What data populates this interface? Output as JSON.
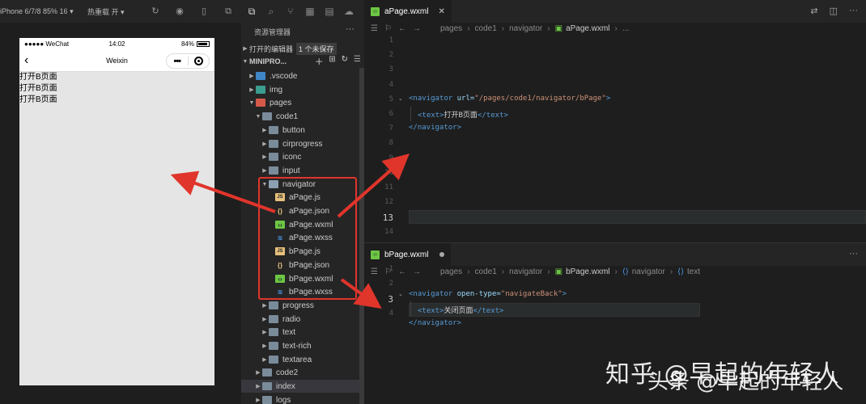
{
  "simulator": {
    "device_label": "iPhone 6/7/8 85% 16 ▾",
    "hot_reload_label": "热重载 开 ▾",
    "phone": {
      "carrier": "●●●●● WeChat",
      "time": "14:02",
      "battery": "84%",
      "nav_title": "Weixin",
      "body_lines": [
        "打开B页面",
        "打开B页面",
        "打开B页面"
      ]
    }
  },
  "explorer": {
    "header": "资源管理器",
    "more": "···",
    "open_editors_label": "打开的编辑器",
    "unsaved_badge": "1 个未保存",
    "project_label": "MINIPRO...",
    "items": [
      {
        "name": ".vscode",
        "type": "folder",
        "color": "blue",
        "level": 1,
        "expanded": false
      },
      {
        "name": "img",
        "type": "folder",
        "color": "green",
        "level": 1,
        "expanded": false
      },
      {
        "name": "pages",
        "type": "folder",
        "color": "red",
        "level": 1,
        "expanded": true
      },
      {
        "name": "code1",
        "type": "folder",
        "color": "grey",
        "level": 2,
        "expanded": true
      },
      {
        "name": "button",
        "type": "folder",
        "color": "grey",
        "level": 3,
        "expanded": false
      },
      {
        "name": "cirprogress",
        "type": "folder",
        "color": "grey",
        "level": 3,
        "expanded": false
      },
      {
        "name": "iconc",
        "type": "folder",
        "color": "grey",
        "level": 3,
        "expanded": false
      },
      {
        "name": "input",
        "type": "folder",
        "color": "grey",
        "level": 3,
        "expanded": false
      },
      {
        "name": "navigator",
        "type": "folder",
        "color": "open",
        "level": 3,
        "expanded": true
      },
      {
        "name": "aPage.js",
        "type": "js",
        "level": 4
      },
      {
        "name": "aPage.json",
        "type": "json",
        "level": 4
      },
      {
        "name": "aPage.wxml",
        "type": "wxml",
        "level": 4
      },
      {
        "name": "aPage.wxss",
        "type": "wxss",
        "level": 4
      },
      {
        "name": "bPage.js",
        "type": "js",
        "level": 4
      },
      {
        "name": "bPage.json",
        "type": "json",
        "level": 4
      },
      {
        "name": "bPage.wxml",
        "type": "wxml",
        "level": 4
      },
      {
        "name": "bPage.wxss",
        "type": "wxss",
        "level": 4
      },
      {
        "name": "progress",
        "type": "folder",
        "color": "grey",
        "level": 3,
        "expanded": false
      },
      {
        "name": "radio",
        "type": "folder",
        "color": "grey",
        "level": 3,
        "expanded": false
      },
      {
        "name": "text",
        "type": "folder",
        "color": "grey",
        "level": 3,
        "expanded": false
      },
      {
        "name": "text-rich",
        "type": "folder",
        "color": "grey",
        "level": 3,
        "expanded": false
      },
      {
        "name": "textarea",
        "type": "folder",
        "color": "grey",
        "level": 3,
        "expanded": false
      },
      {
        "name": "code2",
        "type": "folder",
        "color": "grey",
        "level": 2,
        "expanded": false
      },
      {
        "name": "index",
        "type": "folder",
        "color": "grey",
        "level": 2,
        "expanded": false,
        "selected": true
      },
      {
        "name": "logs",
        "type": "folder",
        "color": "grey",
        "level": 2,
        "expanded": false
      }
    ]
  },
  "editor_a": {
    "tab_label": "aPage.wxml",
    "breadcrumb": [
      "pages",
      "code1",
      "navigator",
      "aPage.wxml",
      "..."
    ],
    "line_numbers": [
      "1",
      "2",
      "3",
      "4",
      "5",
      "6",
      "7",
      "8",
      "9",
      "10",
      "11",
      "12",
      "13",
      "14"
    ],
    "current_line": "13",
    "code": {
      "open_tag": "<navigator",
      "url_attr": "url=",
      "url_val": "\"/pages/code1/navigator/bPage\"",
      "close_bracket": ">",
      "text_open": "<text>",
      "text_content": "打开B页面",
      "text_close": "</text>",
      "nav_close": "</navigator>"
    }
  },
  "editor_b": {
    "tab_label": "bPage.wxml",
    "breadcrumb": [
      "pages",
      "code1",
      "navigator",
      "bPage.wxml",
      "navigator",
      "text"
    ],
    "line_numbers": [
      "1",
      "2",
      "3",
      "4"
    ],
    "current_line": "3",
    "code": {
      "open_tag": "<navigator",
      "attr": "open-type=",
      "val": "\"navigateBack\"",
      "close_bracket": ">",
      "text_open": "<text>",
      "text_content": "关闭页面",
      "text_close": "</text>",
      "nav_close": "</navigator>"
    }
  },
  "watermark": {
    "line1": "知乎 @早起的年轻人",
    "line2": "头条 @早起的年轻人"
  },
  "colors": {
    "arrow": "#e0352b",
    "wxml": "#6cc644",
    "wxss": "#4d9cf0",
    "js": "#e5c07b"
  }
}
